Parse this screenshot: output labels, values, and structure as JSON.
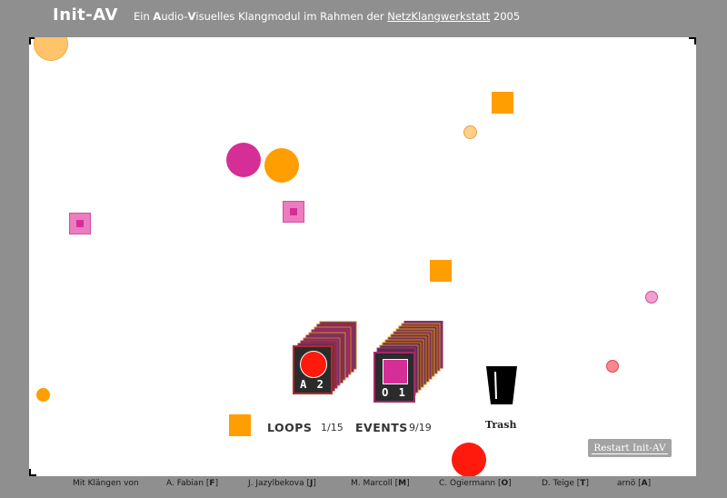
{
  "header": {
    "title": "Init-AV",
    "subtitle_prefix": "Ein ",
    "subtitle_a": "A",
    "subtitle_mid1": "udio-",
    "subtitle_v": "V",
    "subtitle_mid2": "isuelles Klangmodul im Rahmen der ",
    "subtitle_link": "NetzKlangwerkstatt",
    "subtitle_suffix": " 2005"
  },
  "colors": {
    "background": "#8f8f8f",
    "stage": "#ffffff",
    "orange": "#ff9e00",
    "light_orange": "#ffc46a",
    "magenta": "#d62e97",
    "pink": "#ec7cc0",
    "red": "#ff1a0d",
    "light_red": "#f7898d"
  },
  "loop_stack": {
    "label": "A 2",
    "icon": "red-circle-icon"
  },
  "event_stack": {
    "label": "O 1",
    "icon": "magenta-square-icon"
  },
  "status": {
    "loops_label": "LOOPS",
    "loops_count": "1/15",
    "events_label": "EVENTS",
    "events_count": "9/19"
  },
  "trash": {
    "label": "Trash",
    "icon": "trash-bin-icon"
  },
  "restart_button": {
    "label": "Restart Init-AV"
  },
  "credits": {
    "intro": "Mit Klängen von",
    "artists": [
      {
        "name": "A. Fabian",
        "key": "F"
      },
      {
        "name": "J. Jazylbekova",
        "key": "J"
      },
      {
        "name": "M. Marcoll",
        "key": "M"
      },
      {
        "name": "C. Ogiermann",
        "key": "O"
      },
      {
        "name": "D. Teige",
        "key": "T"
      },
      {
        "name": "arnö",
        "key": "A"
      }
    ]
  }
}
